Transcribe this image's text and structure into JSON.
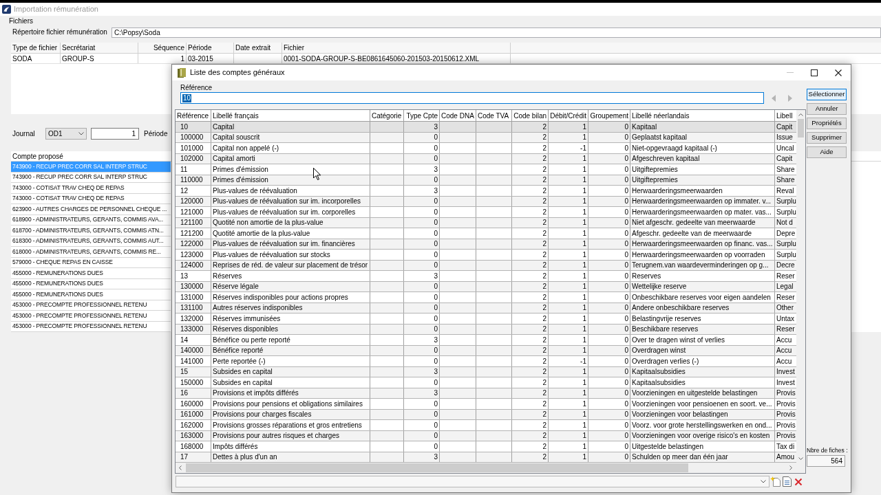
{
  "background_window": {
    "title": "Importation rémunération",
    "active": false,
    "section_label": "Fichiers",
    "directory": {
      "label": "Répertoire fichier rémunération",
      "value": "C:\\Popsy\\Soda"
    },
    "files_table": {
      "columns": [
        "Type de fichier",
        "Secrétariat",
        "Séquence",
        "Période",
        "Date extrait",
        "Fichier"
      ],
      "rows": [
        {
          "type_de_fichier": "SODA",
          "secretariat": "GROUP-S",
          "sequence": "1",
          "periode": "03-2015",
          "fichier": "0001-SODA-GROUP-S-BE0861645060-201503-20150612.XML"
        }
      ]
    },
    "journal": {
      "label": "Journal",
      "value": "OD1",
      "number": "1",
      "period_label": "Période"
    },
    "proposed_accounts": {
      "header": "Compte proposé",
      "items": [
        {
          "label": "743900 - RECUP PREC CORR SAL INTERP STRUC",
          "selected": true
        },
        {
          "label": "743900 - RECUP PREC CORR SAL INTERP STRUC",
          "selected": false
        },
        {
          "label": "743000 - COTISAT TRAV CHEQ DE REPAS",
          "selected": false
        },
        {
          "label": "743000 - COTISAT TRAV CHEQ DE REPAS",
          "selected": false
        },
        {
          "label": "623900 - AUTRES CHARGES DE PERSONNEL CHEQUE ...",
          "selected": false
        },
        {
          "label": "618900 - ADMINISTRATEURS, GERANTS, COMMIS AVA...",
          "selected": false
        },
        {
          "label": "618700 - ADMINISTRATEURS, GERANTS, COMMIS ATN...",
          "selected": false
        },
        {
          "label": "618300 - ADMINISTRATEURS, GERANTS, COMMIS AUT...",
          "selected": false
        },
        {
          "label": "618000 - ADMINISTRATEURS, GERANTS, COMMIS RE...",
          "selected": false
        },
        {
          "label": "579000 - CHEQUE REPAS EN CAISSE",
          "selected": false
        },
        {
          "label": "455000 - REMUNERATIONS DUES",
          "selected": false
        },
        {
          "label": "455000 - REMUNERATIONS DUES",
          "selected": false
        },
        {
          "label": "455000 - REMUNERATIONS DUES",
          "selected": false
        },
        {
          "label": "453000 - PRECOMPTE PROFESSIONNEL RETENU",
          "selected": false
        },
        {
          "label": "453000 - PRECOMPTE PROFESSIONNEL RETENU",
          "selected": false
        },
        {
          "label": "453000 - PRECOMPTE PROFESSIONNEL RETENU",
          "selected": false
        }
      ]
    }
  },
  "dialog": {
    "title": "Liste des comptes généraux",
    "window_controls": [
      {
        "kind": "minimize",
        "disabled": true
      },
      {
        "kind": "maximize",
        "disabled": false
      },
      {
        "kind": "close",
        "disabled": false
      }
    ],
    "reference": {
      "label": "Référence",
      "value": "10",
      "value_selected": true
    },
    "nav_arrows": [
      {
        "kind": "previous",
        "disabled": true
      },
      {
        "kind": "next",
        "disabled": true
      }
    ],
    "table": {
      "columns": [
        "Référence",
        "Libellé français",
        "Catégorie",
        "Type Cpte",
        "Code DNA",
        "Code TVA",
        "Code bilan",
        "Débit/Crédit",
        "Groupement",
        "Libellé néerlandais",
        "Libell"
      ],
      "rows": [
        {
          "reference": "10",
          "libelle_francais": "Capital",
          "type_cpte": "3",
          "code_bilan": "2",
          "debit_credit": "1",
          "groupement": "0",
          "libelle_neerlandais": "Kapitaal",
          "column_11": "Capit",
          "selected": true
        },
        {
          "reference": "100000",
          "libelle_francais": "Capital souscrit",
          "type_cpte": "0",
          "code_bilan": "2",
          "debit_credit": "1",
          "groupement": "0",
          "libelle_neerlandais": "Geplaatst kapitaal",
          "column_11": "Issue",
          "selected": false
        },
        {
          "reference": "101000",
          "libelle_francais": "Capital non appelé (-)",
          "type_cpte": "0",
          "code_bilan": "2",
          "debit_credit": "-1",
          "groupement": "0",
          "libelle_neerlandais": "Niet-opgevraagd kapitaal (-)",
          "column_11": "Uncal",
          "selected": false
        },
        {
          "reference": "102000",
          "libelle_francais": "Capital amorti",
          "type_cpte": "0",
          "code_bilan": "2",
          "debit_credit": "1",
          "groupement": "0",
          "libelle_neerlandais": "Afgeschreven kapitaal",
          "column_11": "Capit",
          "selected": false
        },
        {
          "reference": "11",
          "libelle_francais": "Primes d'émission",
          "type_cpte": "3",
          "code_bilan": "2",
          "debit_credit": "1",
          "groupement": "0",
          "libelle_neerlandais": "Uitgiftepremies",
          "column_11": "Share",
          "selected": false
        },
        {
          "reference": "110000",
          "libelle_francais": "Primes d'émission",
          "type_cpte": "0",
          "code_bilan": "2",
          "debit_credit": "1",
          "groupement": "0",
          "libelle_neerlandais": "Uitgiftepremies",
          "column_11": "Share",
          "selected": false
        },
        {
          "reference": "12",
          "libelle_francais": "Plus-values de réévaluation",
          "type_cpte": "3",
          "code_bilan": "2",
          "debit_credit": "1",
          "groupement": "0",
          "libelle_neerlandais": "Herwaarderingsmeerwaarden",
          "column_11": "Reval",
          "selected": false
        },
        {
          "reference": "120000",
          "libelle_francais": "Plus-values de réévaluation sur im. incorporelles",
          "type_cpte": "0",
          "code_bilan": "2",
          "debit_credit": "1",
          "groupement": "0",
          "libelle_neerlandais": "Herwaarderingsmeerwaarden op immater. v...",
          "column_11": "Surplu",
          "selected": false
        },
        {
          "reference": "121000",
          "libelle_francais": "Plus-values de réévaluation sur im. corporelles",
          "type_cpte": "0",
          "code_bilan": "2",
          "debit_credit": "1",
          "groupement": "0",
          "libelle_neerlandais": "Herwaarderingsmeerwaarden op mater. vas...",
          "column_11": "Surplu",
          "selected": false
        },
        {
          "reference": "121100",
          "libelle_francais": "Quotité non amortie de la plus-value",
          "type_cpte": "0",
          "code_bilan": "2",
          "debit_credit": "1",
          "groupement": "0",
          "libelle_neerlandais": "Niet afgeschr. gedeelte van meerwaarde",
          "column_11": "Not d",
          "selected": false
        },
        {
          "reference": "121200",
          "libelle_francais": "Quotité amortie de la plus-value",
          "type_cpte": "0",
          "code_bilan": "2",
          "debit_credit": "1",
          "groupement": "0",
          "libelle_neerlandais": "Afgeschr. gedeelte van de meerwaarde",
          "column_11": "Depre",
          "selected": false
        },
        {
          "reference": "122000",
          "libelle_francais": "Plus-values de réévaluation sur im. financières",
          "type_cpte": "0",
          "code_bilan": "2",
          "debit_credit": "1",
          "groupement": "0",
          "libelle_neerlandais": "Herwaarderingsmeerwaarden op financ. vas...",
          "column_11": "Surplu",
          "selected": false
        },
        {
          "reference": "123000",
          "libelle_francais": "Plus-values de réévaluation sur stocks",
          "type_cpte": "0",
          "code_bilan": "2",
          "debit_credit": "1",
          "groupement": "0",
          "libelle_neerlandais": "Herwaarderingsmeerwaarden op voorraden",
          "column_11": "Surplu",
          "selected": false
        },
        {
          "reference": "124000",
          "libelle_francais": "Reprises de réd. de valeur sur placement de trésor",
          "type_cpte": "0",
          "code_bilan": "2",
          "debit_credit": "1",
          "groupement": "0",
          "libelle_neerlandais": "Terugnem.van waardeverminderingen op g...",
          "column_11": "Decre",
          "selected": false
        },
        {
          "reference": "13",
          "libelle_francais": "Réserves",
          "type_cpte": "3",
          "code_bilan": "2",
          "debit_credit": "1",
          "groupement": "0",
          "libelle_neerlandais": "Reserves",
          "column_11": "Reser",
          "selected": false
        },
        {
          "reference": "130000",
          "libelle_francais": "Réserve légale",
          "type_cpte": "0",
          "code_bilan": "2",
          "debit_credit": "1",
          "groupement": "0",
          "libelle_neerlandais": "Wettelijke reserve",
          "column_11": "Legal",
          "selected": false
        },
        {
          "reference": "131000",
          "libelle_francais": "Réserves indisponibles pour actions propres",
          "type_cpte": "0",
          "code_bilan": "2",
          "debit_credit": "1",
          "groupement": "0",
          "libelle_neerlandais": "Onbeschikbare reserves voor eigen aandelen",
          "column_11": "Reser",
          "selected": false
        },
        {
          "reference": "131100",
          "libelle_francais": "Autres réserves indisponibles",
          "type_cpte": "0",
          "code_bilan": "2",
          "debit_credit": "1",
          "groupement": "0",
          "libelle_neerlandais": "Andere onbeschikbare reserves",
          "column_11": "Other",
          "selected": false
        },
        {
          "reference": "132000",
          "libelle_francais": "Réserves immunisées",
          "type_cpte": "0",
          "code_bilan": "2",
          "debit_credit": "1",
          "groupement": "0",
          "libelle_neerlandais": "Belastingvrije reserves",
          "column_11": "Untax",
          "selected": false
        },
        {
          "reference": "133000",
          "libelle_francais": "Réserves disponibles",
          "type_cpte": "0",
          "code_bilan": "2",
          "debit_credit": "1",
          "groupement": "0",
          "libelle_neerlandais": "Beschikbare reserves",
          "column_11": "Reser",
          "selected": false
        },
        {
          "reference": "14",
          "libelle_francais": "Bénéfice ou perte reporté",
          "type_cpte": "3",
          "code_bilan": "2",
          "debit_credit": "1",
          "groupement": "0",
          "libelle_neerlandais": "Over te dragen winst of verlies",
          "column_11": "Accu",
          "selected": false
        },
        {
          "reference": "140000",
          "libelle_francais": "Bénéfice reporté",
          "type_cpte": "0",
          "code_bilan": "2",
          "debit_credit": "1",
          "groupement": "0",
          "libelle_neerlandais": "Overdragen winst",
          "column_11": "Accu",
          "selected": false
        },
        {
          "reference": "141000",
          "libelle_francais": "Perte reportée (-)",
          "type_cpte": "0",
          "code_bilan": "2",
          "debit_credit": "-1",
          "groupement": "0",
          "libelle_neerlandais": "Overdragen verlies (-)",
          "column_11": "Accu",
          "selected": false
        },
        {
          "reference": "15",
          "libelle_francais": "Subsides en capital",
          "type_cpte": "3",
          "code_bilan": "2",
          "debit_credit": "1",
          "groupement": "0",
          "libelle_neerlandais": "Kapitaalsubsidies",
          "column_11": "Invest",
          "selected": false
        },
        {
          "reference": "150000",
          "libelle_francais": "Subsides en capital",
          "type_cpte": "0",
          "code_bilan": "2",
          "debit_credit": "1",
          "groupement": "0",
          "libelle_neerlandais": "Kapitaalsubsidies",
          "column_11": "Invest",
          "selected": false
        },
        {
          "reference": "16",
          "libelle_francais": "Provisions et impôts différés",
          "type_cpte": "3",
          "code_bilan": "2",
          "debit_credit": "1",
          "groupement": "0",
          "libelle_neerlandais": "Voorzieningen en uitgestelde belastingen",
          "column_11": "Provis",
          "selected": false
        },
        {
          "reference": "160000",
          "libelle_francais": "Provisions pour pensions et obligations similaires",
          "type_cpte": "0",
          "code_bilan": "2",
          "debit_credit": "1",
          "groupement": "0",
          "libelle_neerlandais": "Voorzieningen voor pensioenen en soort. ve...",
          "column_11": "Provis",
          "selected": false
        },
        {
          "reference": "161000",
          "libelle_francais": "Provisions pour charges fiscales",
          "type_cpte": "0",
          "code_bilan": "2",
          "debit_credit": "1",
          "groupement": "0",
          "libelle_neerlandais": "Voorzieningen voor belastingen",
          "column_11": "Provis",
          "selected": false
        },
        {
          "reference": "162000",
          "libelle_francais": "Provisions grosses réparations et gros entretiens",
          "type_cpte": "0",
          "code_bilan": "2",
          "debit_credit": "1",
          "groupement": "0",
          "libelle_neerlandais": "Voorz. voor grote herstellingswerken en ond...",
          "column_11": "Provis",
          "selected": false
        },
        {
          "reference": "163000",
          "libelle_francais": "Provisions pour autres risques et charges",
          "type_cpte": "0",
          "code_bilan": "2",
          "debit_credit": "1",
          "groupement": "0",
          "libelle_neerlandais": "Voorzieningen voor overige risico's en kosten",
          "column_11": "Provis",
          "selected": false
        },
        {
          "reference": "168000",
          "libelle_francais": "Impôts différés",
          "type_cpte": "0",
          "code_bilan": "2",
          "debit_credit": "1",
          "groupement": "0",
          "libelle_neerlandais": "Uitgestelde belastingen",
          "column_11": "Tax di",
          "selected": false
        },
        {
          "reference": "17",
          "libelle_francais": "Dettes à plus d'un an",
          "type_cpte": "3",
          "code_bilan": "2",
          "debit_credit": "1",
          "groupement": "0",
          "libelle_neerlandais": "Schulden op meer dan één jaar",
          "column_11": "Amou",
          "selected": false
        }
      ]
    },
    "buttons": [
      {
        "label": "Sélectionner",
        "default": true
      },
      {
        "label": "Annuler",
        "default": false
      },
      {
        "label": "Propriétés",
        "default": false
      },
      {
        "label": "Supprimer",
        "default": false
      },
      {
        "label": "Aide",
        "default": false
      }
    ],
    "count": {
      "label": "Nbre de fiches :",
      "value": "564"
    }
  }
}
